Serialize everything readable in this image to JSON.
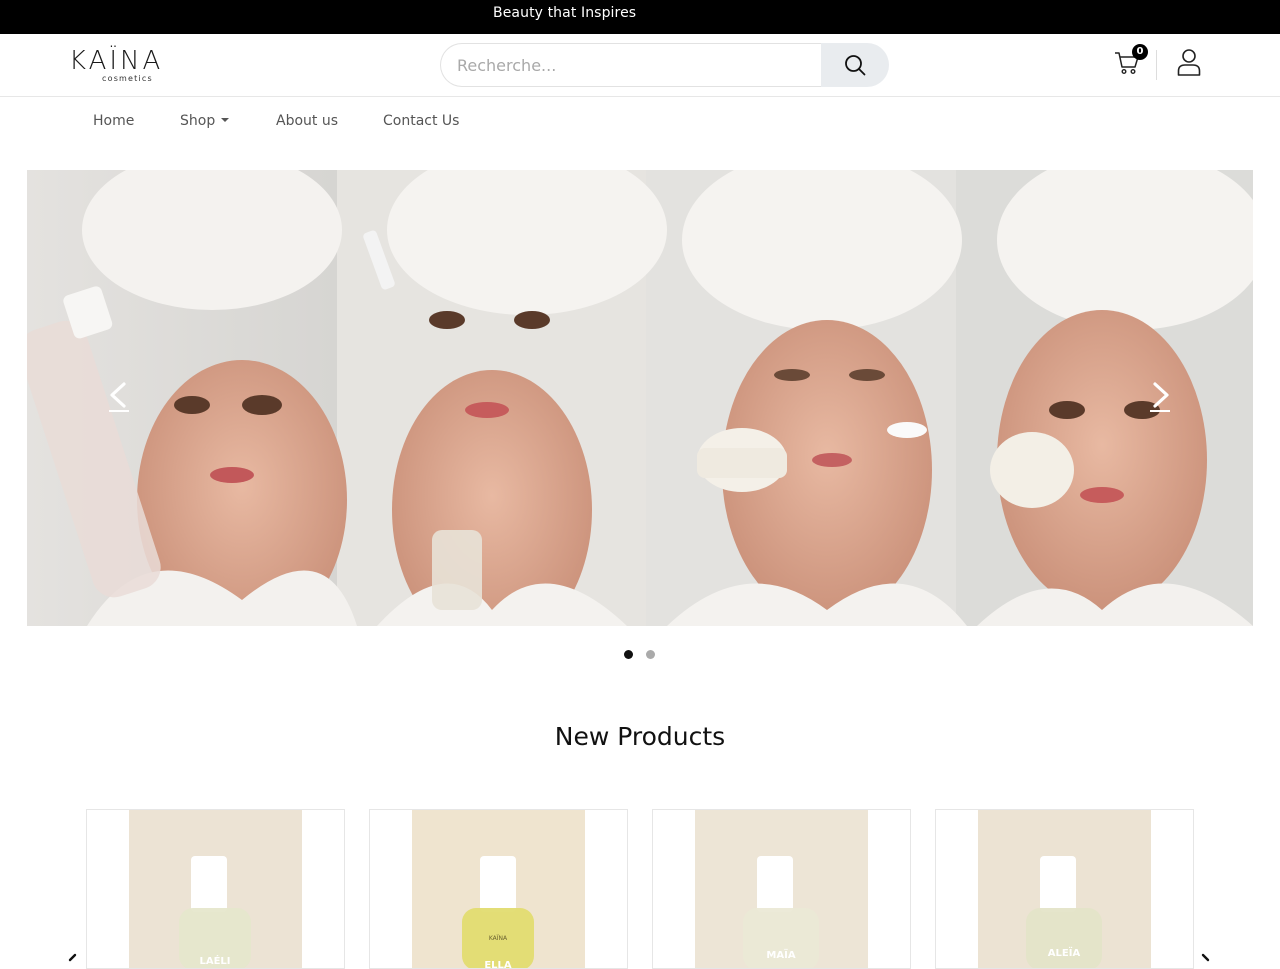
{
  "topbar": {
    "text": "Beauty that Inspires"
  },
  "logo": {
    "name": "KAÏNA",
    "sub": "cosmetics"
  },
  "search": {
    "placeholder": "Recherche..."
  },
  "cart": {
    "count": "0"
  },
  "nav": {
    "items": [
      {
        "label": "Home"
      },
      {
        "label": "Shop",
        "has_dropdown": true
      },
      {
        "label": "About us"
      },
      {
        "label": "Contact Us"
      }
    ]
  },
  "carousel": {
    "slides": 2,
    "active_slide": 1
  },
  "products_section": {
    "title": "New Products",
    "products": [
      {
        "label": "LAÉLI",
        "liquid_color": "#e6e7cc"
      },
      {
        "label": "ELLA",
        "liquid_color": "#e2dc70"
      },
      {
        "label": "MAÏA",
        "liquid_color": "#ebe9d6"
      },
      {
        "label": "ALEÏA",
        "liquid_color": "#e4e4c8"
      }
    ]
  },
  "colors": {
    "topbar": "#000000",
    "accent": "#000000",
    "teal_nails": "#2bb3a8"
  }
}
